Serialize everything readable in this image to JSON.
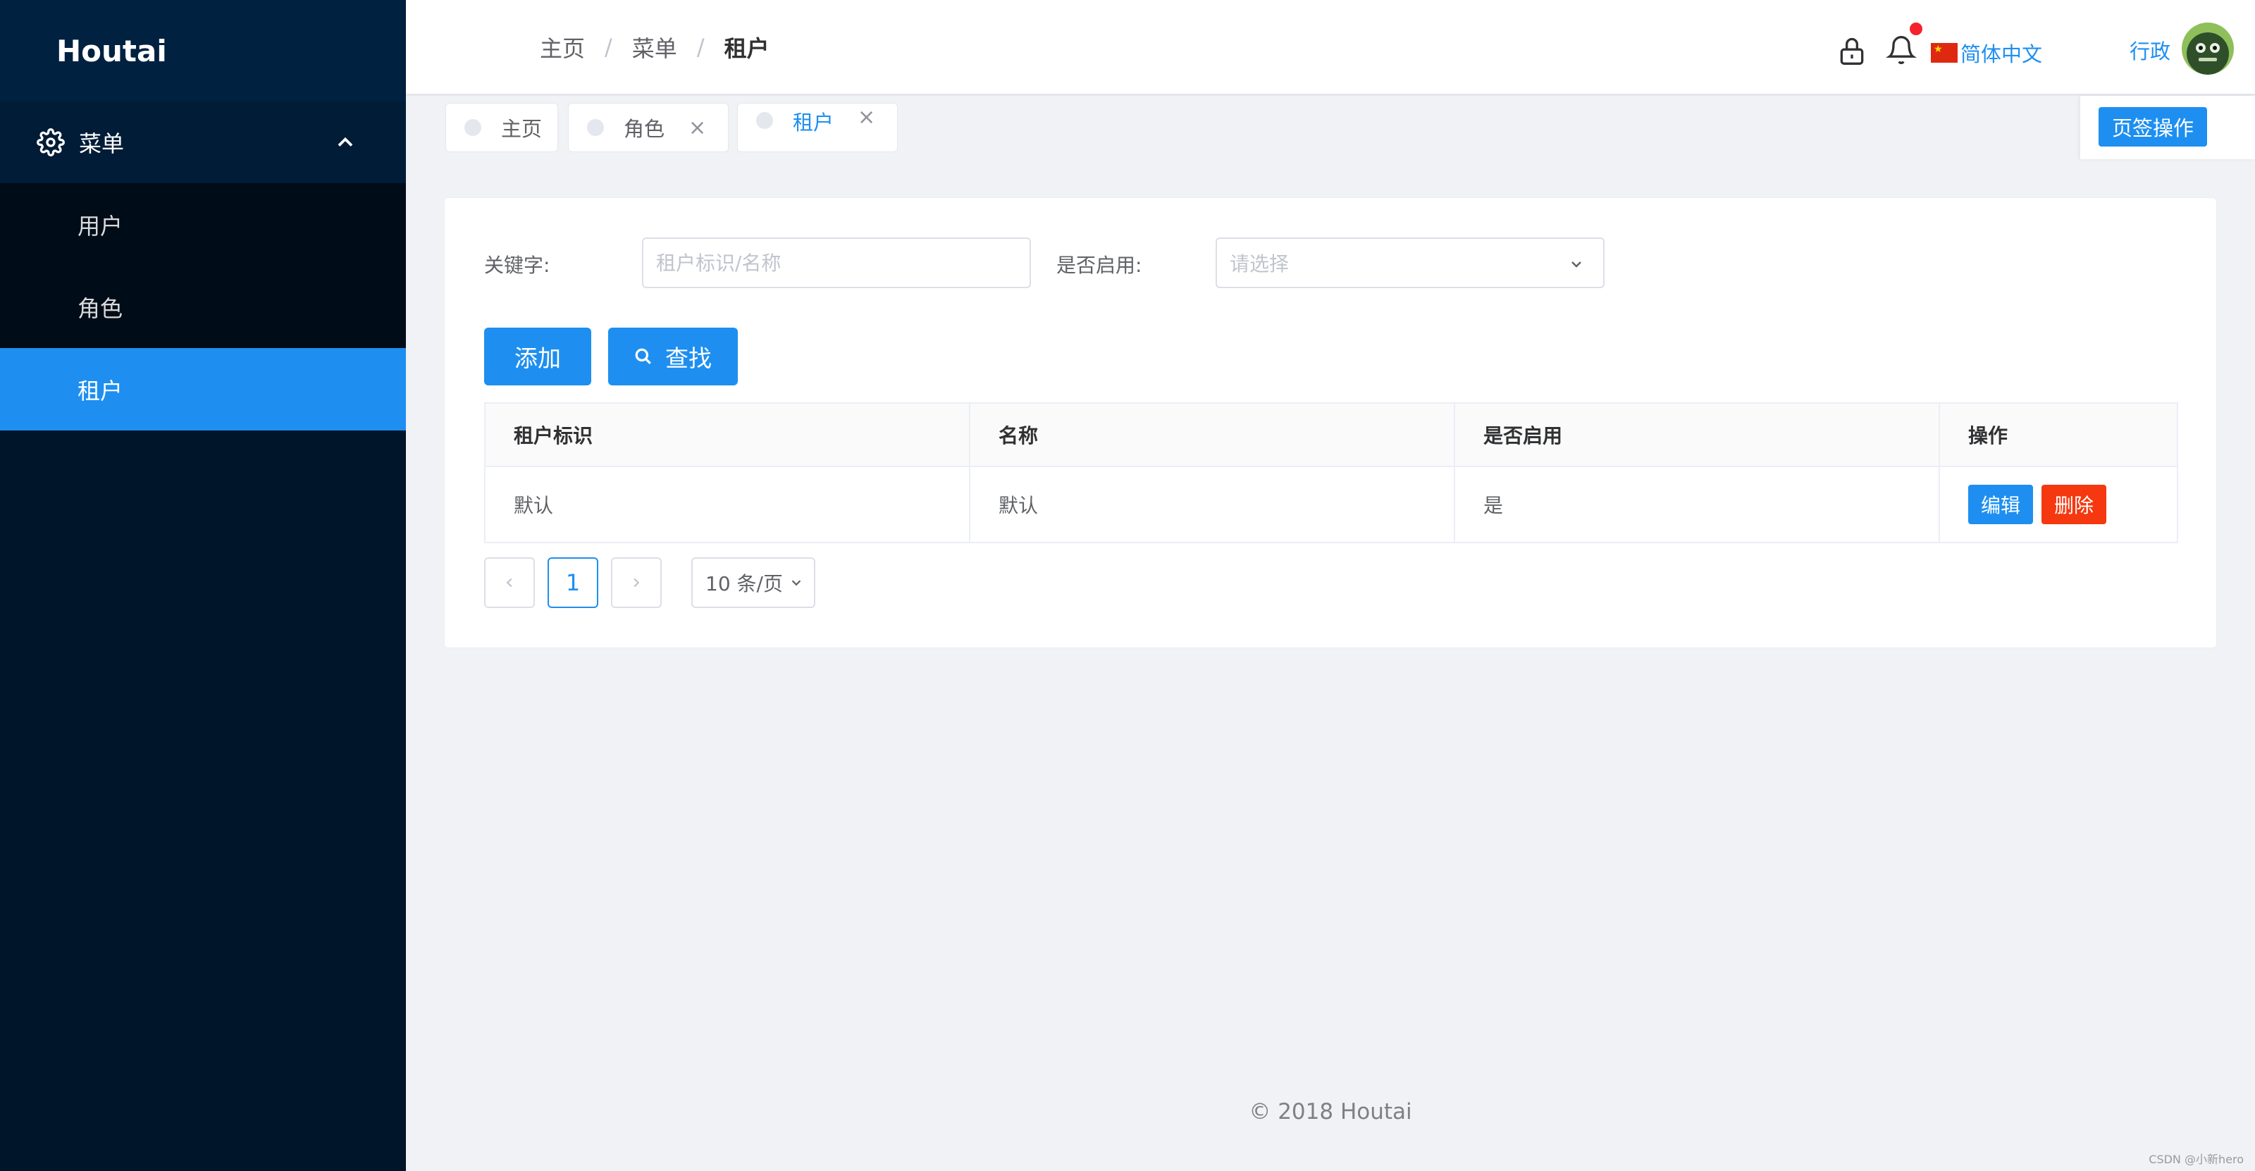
{
  "app": {
    "logo": "Houtai"
  },
  "sidebar": {
    "group_label": "菜单",
    "items": [
      {
        "label": "用户"
      },
      {
        "label": "角色"
      },
      {
        "label": "租户"
      }
    ]
  },
  "header": {
    "breadcrumbs": [
      "主页",
      "菜单",
      "租户"
    ],
    "language": "简体中文",
    "user_name": "行政"
  },
  "tags": {
    "items": [
      {
        "label": "主页"
      },
      {
        "label": "角色"
      },
      {
        "label": "租户"
      }
    ],
    "operations_label": "页签操作"
  },
  "filters": {
    "keyword_label": "关键字:",
    "keyword_placeholder": "租户标识/名称",
    "enabled_label": "是否启用:",
    "enabled_placeholder": "请选择"
  },
  "actions": {
    "add_label": "添加",
    "search_label": "查找"
  },
  "table": {
    "columns": [
      "租户标识",
      "名称",
      "是否启用",
      "操作"
    ],
    "rows": [
      {
        "tenant_id": "默认",
        "name": "默认",
        "enabled": "是"
      }
    ],
    "edit_label": "编辑",
    "delete_label": "删除"
  },
  "pagination": {
    "current_page": "1",
    "page_size": "10 条/页"
  },
  "footer": {
    "copyright": "© 2018 Houtai"
  },
  "watermark": "CSDN @小新hero",
  "colors": {
    "primary": "#1e8ff0",
    "danger": "#f5380f",
    "sidebar_bg": "#001529",
    "badge": "#f5222d"
  }
}
